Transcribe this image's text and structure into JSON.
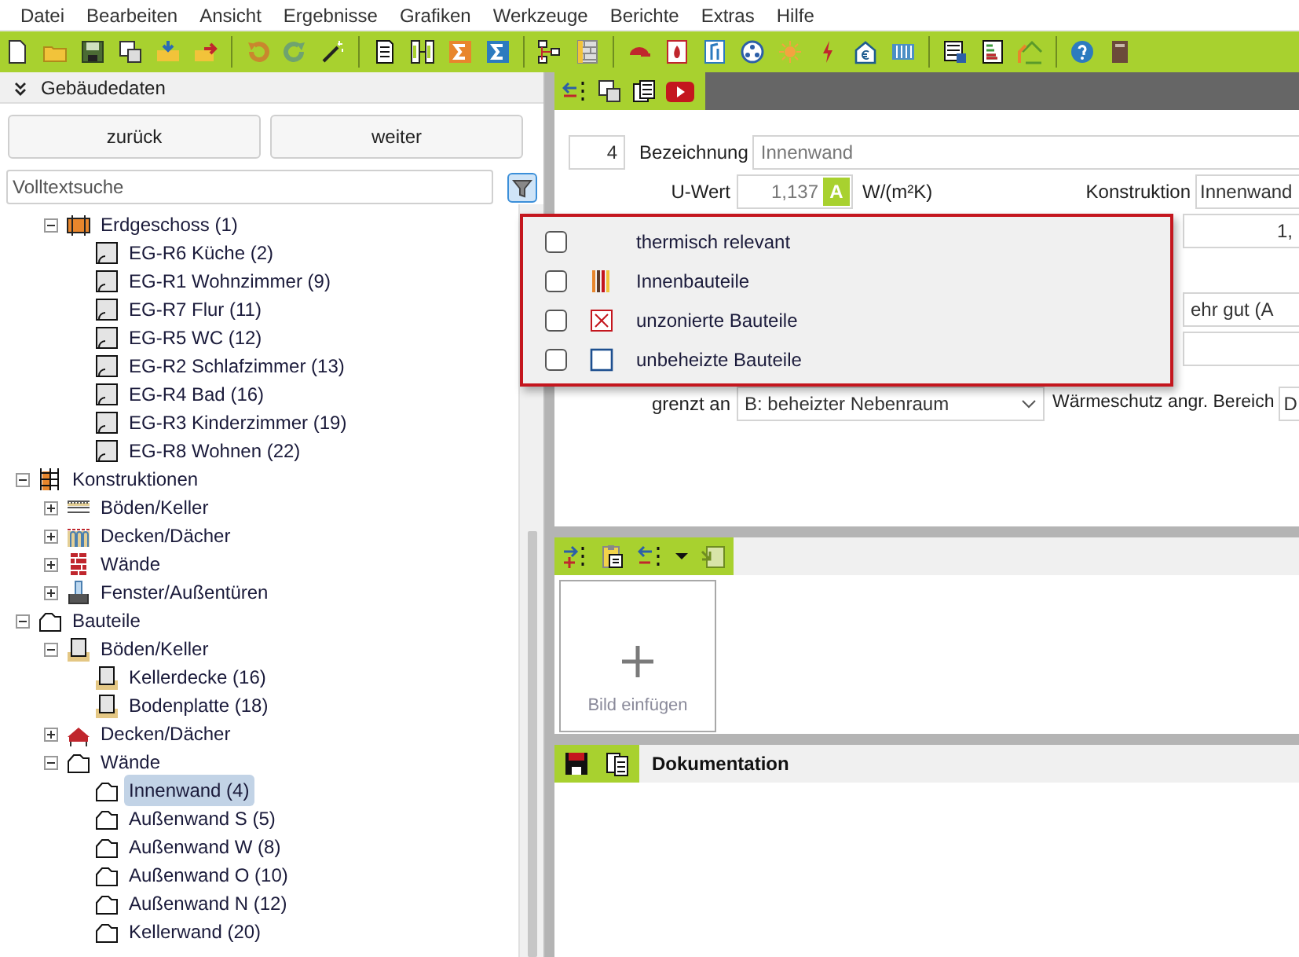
{
  "menu": [
    "Datei",
    "Bearbeiten",
    "Ansicht",
    "Ergebnisse",
    "Grafiken",
    "Werkzeuge",
    "Berichte",
    "Extras",
    "Hilfe"
  ],
  "left_panel": {
    "title": "Gebäudedaten",
    "buttons": [
      "zurück",
      "weiter"
    ],
    "search": {
      "placeholder": "Volltextsuche"
    },
    "tree": {
      "continued": [
        {
          "label": "Erdgeschoss (1)",
          "kind": "storey",
          "expanded": true,
          "selected": false,
          "children": [
            {
              "label": "EG-R6 Küche (2)",
              "kind": "room",
              "selected": false
            },
            {
              "label": "EG-R1 Wohnzimmer (9)",
              "kind": "room",
              "selected": false
            },
            {
              "label": "EG-R7 Flur (11)",
              "kind": "room",
              "selected": false
            },
            {
              "label": "EG-R5 WC (12)",
              "kind": "room",
              "selected": false
            },
            {
              "label": "EG-R2 Schlafzimmer (13)",
              "kind": "room",
              "selected": false
            },
            {
              "label": "EG-R4 Bad (16)",
              "kind": "room",
              "selected": false
            },
            {
              "label": "EG-R3 Kinderzimmer (19)",
              "kind": "room",
              "selected": false
            },
            {
              "label": "EG-R8 Wohnen (22)",
              "kind": "room",
              "selected": false
            }
          ]
        }
      ],
      "nodes": [
        {
          "label": "Konstruktionen",
          "kind": "constructions",
          "expanded": true,
          "selected": false,
          "children": [
            {
              "label": "Böden/Keller",
              "kind": "floor-layers",
              "expanded": false,
              "selected": false
            },
            {
              "label": "Decken/Dächer",
              "kind": "ceilings",
              "expanded": false,
              "selected": false
            },
            {
              "label": "Wände",
              "kind": "bricks",
              "expanded": false,
              "selected": false
            },
            {
              "label": "Fenster/Außentüren",
              "kind": "window",
              "expanded": false,
              "selected": false
            }
          ]
        },
        {
          "label": "Bauteile",
          "kind": "outline",
          "expanded": true,
          "selected": false,
          "children": [
            {
              "label": "Böden/Keller",
              "kind": "floor-part",
              "expanded": true,
              "selected": false,
              "children": [
                {
                  "label": "Kellerdecke (16)",
                  "kind": "floor-part",
                  "selected": false
                },
                {
                  "label": "Bodenplatte (18)",
                  "kind": "floor-part",
                  "selected": false
                }
              ]
            },
            {
              "label": "Decken/Dächer",
              "kind": "roof",
              "expanded": false,
              "selected": false
            },
            {
              "label": "Wände",
              "kind": "outline",
              "expanded": true,
              "selected": false,
              "children": [
                {
                  "label": "Innenwand (4)",
                  "kind": "outline",
                  "selected": true
                },
                {
                  "label": "Außenwand S (5)",
                  "kind": "outline",
                  "selected": false
                },
                {
                  "label": "Außenwand W (8)",
                  "kind": "outline",
                  "selected": false
                },
                {
                  "label": "Außenwand O (10)",
                  "kind": "outline",
                  "selected": false
                },
                {
                  "label": "Außenwand N (12)",
                  "kind": "outline",
                  "selected": false
                },
                {
                  "label": "Kellerwand (20)",
                  "kind": "outline",
                  "selected": false
                }
              ]
            }
          ]
        }
      ]
    }
  },
  "filter_menu": [
    {
      "label": "thermisch relevant",
      "kind": "plain",
      "checked": false
    },
    {
      "label": "Innenbauteile",
      "kind": "inner",
      "checked": false
    },
    {
      "label": "unzonierte Bauteile",
      "kind": "unzoned",
      "checked": false
    },
    {
      "label": "unbeheizte Bauteile",
      "kind": "unheated",
      "checked": false
    }
  ],
  "form": {
    "number": "4",
    "name_label": "Bezeichnung",
    "name_value": "Innenwand",
    "u_label": "U-Wert",
    "u_value": "1,137",
    "u_class": "A",
    "u_unit": "W/(m²K)",
    "construction_label": "Konstruktion",
    "construction_value": "Innenwand",
    "field_3": "1,",
    "field_5": "ehr gut (A",
    "adjacent_label": "grenzt an",
    "adjacent_value": "B: beheizter Nebenraum",
    "protection_label": "Wärmeschutz angr. Bereich",
    "protection_value": "D"
  },
  "image_area": {
    "add_label": "Bild einfügen"
  },
  "documentation": {
    "title": "Dokumentation"
  }
}
